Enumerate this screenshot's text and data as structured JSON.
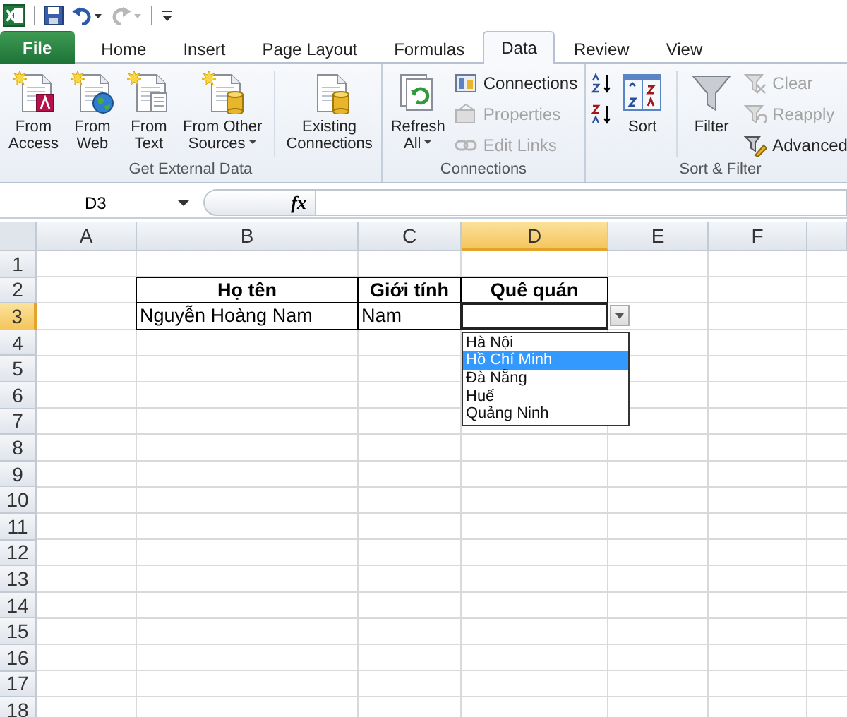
{
  "tabs": [
    {
      "label": "File",
      "kind": "file",
      "selected": false
    },
    {
      "label": "Home",
      "kind": "tab",
      "selected": false
    },
    {
      "label": "Insert",
      "kind": "tab",
      "selected": false
    },
    {
      "label": "Page Layout",
      "kind": "tab",
      "selected": false
    },
    {
      "label": "Formulas",
      "kind": "tab",
      "selected": false
    },
    {
      "label": "Data",
      "kind": "tab",
      "selected": true
    },
    {
      "label": "Review",
      "kind": "tab",
      "selected": false
    },
    {
      "label": "View",
      "kind": "tab",
      "selected": false
    }
  ],
  "ribbon": {
    "groups": [
      {
        "label": "Get External Data",
        "items": [
          {
            "kind": "large",
            "label": "From\nAccess"
          },
          {
            "kind": "large",
            "label": "From\nWeb"
          },
          {
            "kind": "large",
            "label": "From\nText"
          },
          {
            "kind": "large",
            "label": "From Other\nSources",
            "dropdown": true
          },
          {
            "kind": "large",
            "label": "Existing\nConnections",
            "separated": true
          }
        ]
      },
      {
        "label": "Connections",
        "items": [
          {
            "kind": "large",
            "label": "Refresh\nAll",
            "dropdown": true
          },
          {
            "kind": "stack",
            "buttons": [
              {
                "kind": "labelled",
                "label": "Connections",
                "disabled": false
              },
              {
                "kind": "labelled",
                "label": "Properties",
                "disabled": true
              },
              {
                "kind": "labelled",
                "label": "Edit Links",
                "disabled": true
              }
            ]
          }
        ]
      },
      {
        "label": "Sort & Filter",
        "items": [
          {
            "kind": "stack",
            "buttons": [
              {
                "kind": "icon"
              },
              {
                "kind": "icon"
              }
            ]
          },
          {
            "kind": "large",
            "label": "Sort"
          },
          {
            "kind": "large",
            "label": "Filter",
            "separated": true
          },
          {
            "kind": "stack",
            "buttons": [
              {
                "kind": "labelled",
                "label": "Clear",
                "disabled": true
              },
              {
                "kind": "labelled",
                "label": "Reapply",
                "disabled": true
              },
              {
                "kind": "labelled",
                "label": "Advanced",
                "disabled": false
              }
            ]
          }
        ]
      }
    ]
  },
  "formula_bar": {
    "name_box": "D3",
    "function_button": "fx"
  },
  "sheet": {
    "columns": [
      {
        "label": "A",
        "selected": false
      },
      {
        "label": "B",
        "selected": false
      },
      {
        "label": "C",
        "selected": false
      },
      {
        "label": "D",
        "selected": true
      },
      {
        "label": "E",
        "selected": false
      },
      {
        "label": "F",
        "selected": false
      }
    ],
    "rows": [
      {
        "label": "1",
        "selected": false
      },
      {
        "label": "2",
        "selected": false
      },
      {
        "label": "3",
        "selected": true
      },
      {
        "label": "4",
        "selected": false
      },
      {
        "label": "5",
        "selected": false
      },
      {
        "label": "6",
        "selected": false
      },
      {
        "label": "7",
        "selected": false
      },
      {
        "label": "8",
        "selected": false
      },
      {
        "label": "9",
        "selected": false
      },
      {
        "label": "10",
        "selected": false
      },
      {
        "label": "11",
        "selected": false
      },
      {
        "label": "12",
        "selected": false
      },
      {
        "label": "13",
        "selected": false
      },
      {
        "label": "14",
        "selected": false
      },
      {
        "label": "15",
        "selected": false
      },
      {
        "label": "16",
        "selected": false
      },
      {
        "label": "17",
        "selected": false
      },
      {
        "label": "18",
        "selected": false
      }
    ],
    "table": {
      "headers": [
        "Họ tên",
        "Giới tính",
        "Quê quán"
      ],
      "rows": [
        [
          "Nguyễn Hoàng Nam",
          "Nam"
        ]
      ]
    },
    "validation_list": {
      "options": [
        {
          "label": "Hà Nội",
          "selected": false
        },
        {
          "label": "Hồ Chí Minh",
          "selected": true
        },
        {
          "label": "Đà Nẵng",
          "selected": false
        },
        {
          "label": "Huế",
          "selected": false
        },
        {
          "label": "Quảng Ninh",
          "selected": false
        }
      ]
    }
  }
}
